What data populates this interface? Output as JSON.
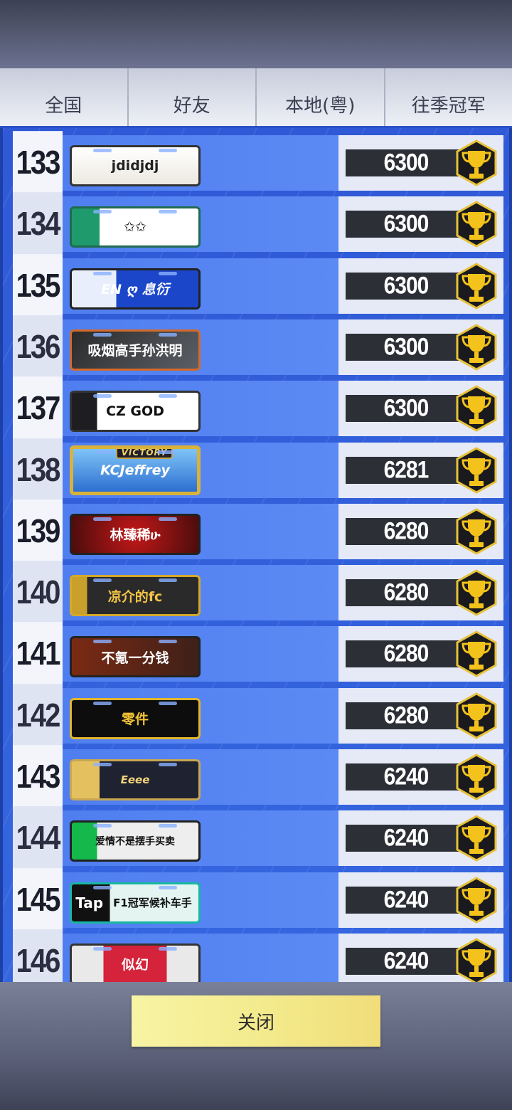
{
  "tabs": [
    {
      "label": "全国"
    },
    {
      "label": "好友"
    },
    {
      "label": "本地(粤)"
    },
    {
      "label": "往季冠军"
    }
  ],
  "rows": [
    {
      "rank": "133",
      "name": "jdidjdj",
      "score": "6300",
      "plate_style": "white"
    },
    {
      "rank": "134",
      "name": "✩✩",
      "score": "6300",
      "plate_style": "green"
    },
    {
      "rank": "135",
      "name": "EN ღ 息衍",
      "score": "6300",
      "plate_style": "blue-hex"
    },
    {
      "rank": "136",
      "name": "吸烟高手孙洪明",
      "score": "6300",
      "plate_style": "dark-orange"
    },
    {
      "rank": "137",
      "name": "CZ GOD",
      "score": "6300",
      "plate_style": "star"
    },
    {
      "rank": "138",
      "name": "KCJeffrey",
      "score": "6281",
      "plate_style": "victory",
      "tag": "VICTORY"
    },
    {
      "rank": "139",
      "name": "林臻稀ሁ",
      "score": "6280",
      "plate_style": "red-burst"
    },
    {
      "rank": "140",
      "name": "凉介的fc",
      "score": "6280",
      "plate_style": "carbon-gold"
    },
    {
      "rank": "141",
      "name": "不氪一分钱",
      "score": "6280",
      "plate_style": "ms"
    },
    {
      "rank": "142",
      "name": "零件",
      "score": "6280",
      "plate_style": "black-gold"
    },
    {
      "rank": "143",
      "name": "Eeee",
      "score": "6240",
      "plate_style": "diamond"
    },
    {
      "rank": "144",
      "name": "爱情不是摆手买卖",
      "score": "6240",
      "plate_style": "comic"
    },
    {
      "rank": "145",
      "name": "F1冠军候补车手",
      "score": "6240",
      "plate_style": "tap",
      "badge": "Tap"
    },
    {
      "rank": "146",
      "name": "似幻",
      "score": "6240",
      "plate_style": "xmas"
    }
  ],
  "close_button": {
    "label": "关闭"
  },
  "colors": {
    "list_bg": "#3566e0",
    "score_bar": "#2c2f36",
    "trophy_gold": "#f3c21b",
    "close_btn": "#f5ee98"
  }
}
